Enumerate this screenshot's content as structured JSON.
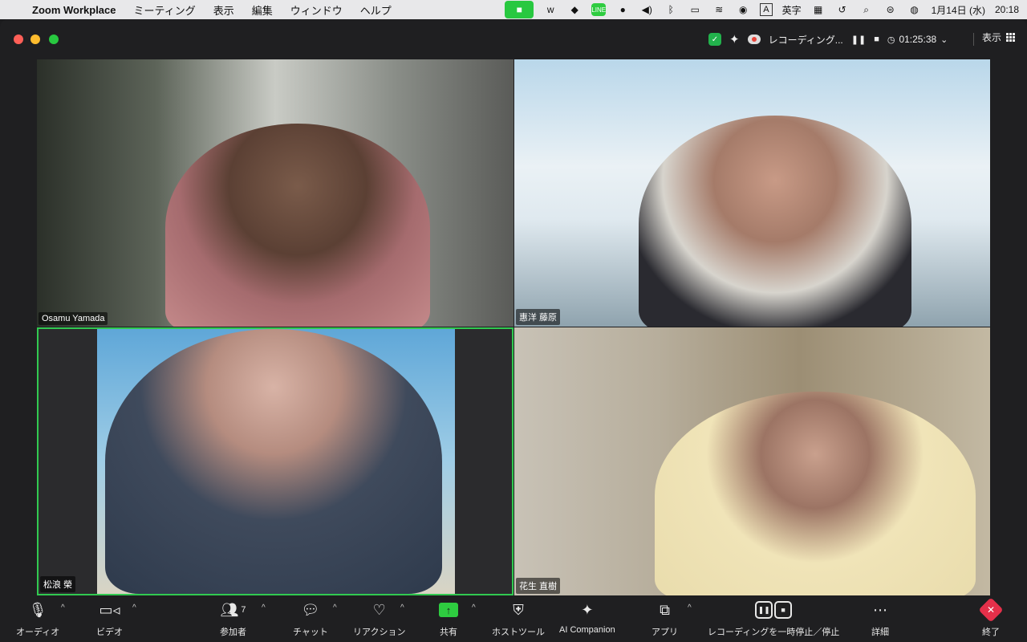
{
  "menubar": {
    "app_name": "Zoom Workplace",
    "menus": [
      "ミーティング",
      "表示",
      "編集",
      "ウィンドウ",
      "ヘルプ"
    ],
    "ime_label": "A",
    "ime_mode": "英字",
    "datetime": "1月14日 (水)",
    "clock": "20:18"
  },
  "header": {
    "recording_label": "レコーディング...",
    "timer": "01:25:38",
    "view_label": "表示"
  },
  "tiles": [
    {
      "name": "Osamu Yamada"
    },
    {
      "name": "惠洋 藤原"
    },
    {
      "name": "松浪 榮"
    },
    {
      "name": "花生 直樹"
    }
  ],
  "toolbar": {
    "audio": "オーディオ",
    "video": "ビデオ",
    "participants": "参加者",
    "participants_count": "7",
    "chat": "チャット",
    "reactions": "リアクション",
    "share": "共有",
    "host_tools": "ホストツール",
    "ai_companion": "AI Companion",
    "apps": "アプリ",
    "recording_control": "レコーディングを一時停止／停止",
    "more": "詳細",
    "end": "終了"
  },
  "colors": {
    "active_speaker_border": "#31c950",
    "share_green": "#2ecc40",
    "end_red": "#e5304a"
  }
}
